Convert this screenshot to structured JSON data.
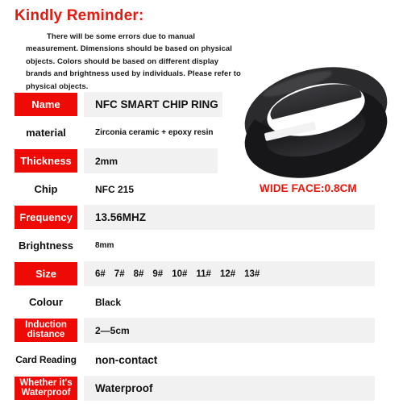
{
  "reminder": {
    "title": "Kindly Reminder:",
    "body": "There will be some errors due to manual measurement. Dimensions should be based on physical objects. Colors should be based on different display brands and brightness used by individuals. Please refer to physical objects."
  },
  "photo": {
    "alt_name": "nfc-smart-chip-ring-photo",
    "annotation": "WIDE FACE:0.8CM",
    "annotation_color": "#e8170c",
    "ring_color": "#2b2b2e"
  },
  "colors": {
    "label_red": "#ee0b05",
    "value_band": "#f1f1f1",
    "title_red": "#e01b10",
    "text": "#111111"
  },
  "spec": {
    "rows": [
      {
        "label": "Name",
        "value": "NFC SMART CHIP RING",
        "style": "red"
      },
      {
        "label": "material",
        "value": "Zirconia ceramic + epoxy resin",
        "style": "plain"
      },
      {
        "label": "Thickness",
        "value": "2mm",
        "style": "red"
      },
      {
        "label": "Chip",
        "value": "NFC 215",
        "style": "plain"
      },
      {
        "label": "Frequency",
        "value": "13.56MHZ",
        "style": "red"
      },
      {
        "label": "Brightness",
        "value": "8mm",
        "style": "plain"
      },
      {
        "label": "Size",
        "value": "",
        "style": "red"
      },
      {
        "label": "Colour",
        "value": "Black",
        "style": "plain"
      },
      {
        "label": "Induction distance",
        "value": "2—5cm",
        "style": "red"
      },
      {
        "label": "Card Reading",
        "value": "non-contact",
        "style": "plain"
      },
      {
        "label": "Whether it's Waterproof",
        "value": "Waterproof",
        "style": "red"
      }
    ],
    "sizes": [
      "6#",
      "7#",
      "8#",
      "9#",
      "10#",
      "11#",
      "12#",
      "13#"
    ]
  }
}
